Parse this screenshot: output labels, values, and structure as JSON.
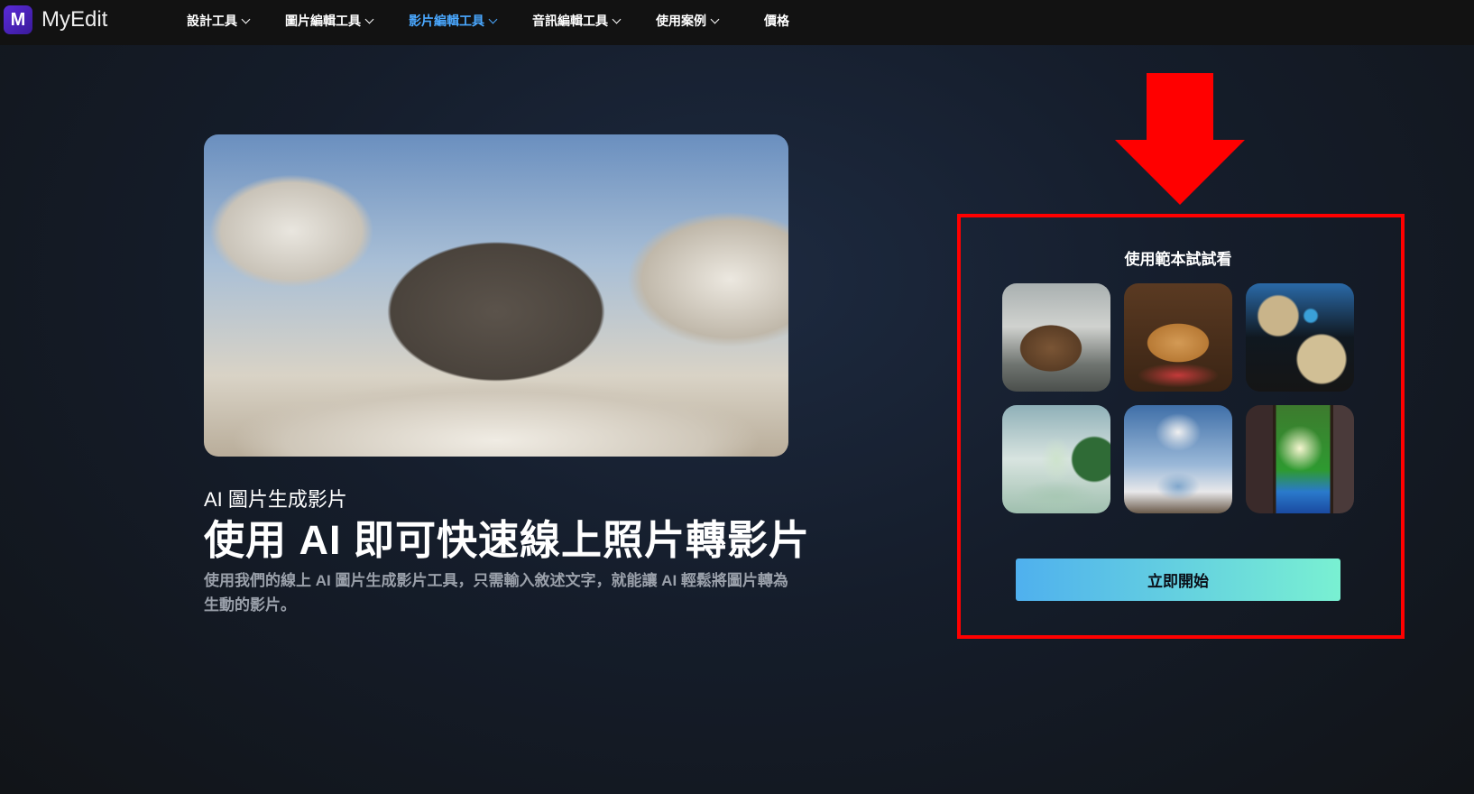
{
  "header": {
    "logo_mark": "M",
    "brand": "MyEdit",
    "nav": [
      {
        "label": "設計工具",
        "has_dropdown": true
      },
      {
        "label": "圖片編輯工具",
        "has_dropdown": true
      },
      {
        "label": "影片編輯工具",
        "has_dropdown": true,
        "active": true
      },
      {
        "label": "音訊編輯工具",
        "has_dropdown": true
      },
      {
        "label": "使用案例",
        "has_dropdown": true
      },
      {
        "label": "價格",
        "has_dropdown": false
      }
    ]
  },
  "hero": {
    "subtitle": "AI 圖片生成影片",
    "title": "使用 AI 即可快速線上照片轉影片",
    "description": "使用我們的線上 AI 圖片生成影片工具，只需輸入敘述文字，就能讓 AI 輕鬆將圖片轉為生動的影片。"
  },
  "templates": {
    "heading": "使用範本試試看",
    "start_button": "立即開始"
  },
  "colors": {
    "accent": "#4aa8ff",
    "annotation": "#ff0000",
    "button_start": "#4fb0ee",
    "button_end": "#79f0d2"
  }
}
